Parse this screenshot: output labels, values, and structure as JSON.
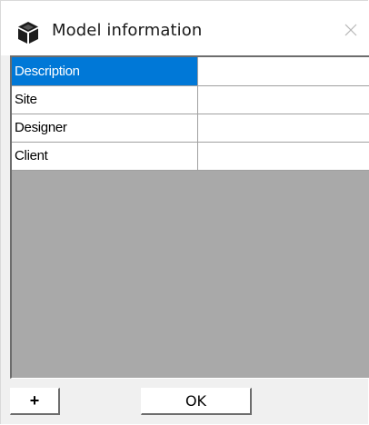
{
  "window": {
    "title": "Model information",
    "title_icon": "cube-icon",
    "close_icon": "close-icon"
  },
  "properties": {
    "rows": [
      {
        "name": "Description",
        "value": "",
        "selected": true
      },
      {
        "name": "Site",
        "value": "",
        "selected": false
      },
      {
        "name": "Designer",
        "value": "",
        "selected": false
      },
      {
        "name": "Client",
        "value": "",
        "selected": false
      }
    ]
  },
  "footer": {
    "add_label": "+",
    "ok_label": "OK"
  },
  "colors": {
    "selection": "#0078d7",
    "grid_background": "#a9a9a9"
  }
}
